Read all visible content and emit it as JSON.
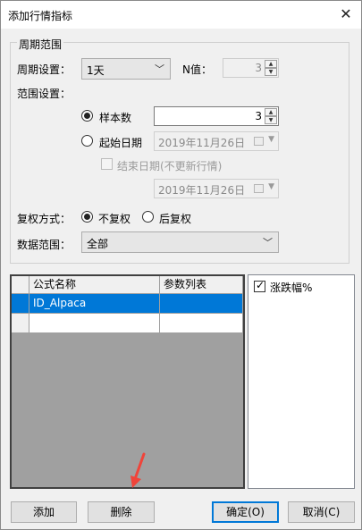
{
  "window": {
    "title": "添加行情指标",
    "close_glyph": "✕"
  },
  "period_group": {
    "title": "周期范围",
    "period_label": "周期设置：",
    "period_value": "1天",
    "n_label": "N值：",
    "n_value": "3",
    "range_label": "范围设置：",
    "sample_label": "样本数",
    "sample_value": "3",
    "start_date_label": "起始日期",
    "start_date_value": "2019年11月26日",
    "end_date_label": "结束日期(不更新行情)",
    "end_date_value": "2019年11月26日",
    "adjust_label": "复权方式：",
    "no_adjust_label": "不复权",
    "back_adjust_label": "后复权",
    "data_range_label": "数据范围：",
    "data_range_value": "全部"
  },
  "formula_table": {
    "columns": [
      "公式名称",
      "参数列表"
    ],
    "rows": [
      {
        "name": "ID_Alpaca",
        "params": ""
      }
    ]
  },
  "indicator_panel": {
    "item_label": "涨跌幅%",
    "checked": true
  },
  "buttons": {
    "add": "添加",
    "delete": "删除",
    "ok": "确定(O)",
    "cancel": "取消(C)"
  },
  "colors": {
    "selection": "#0078d7",
    "annotation_arrow": "#f0443a"
  },
  "icons": {
    "dropdown": "chevron-down-icon",
    "spin_up": "up-triangle-icon",
    "spin_down": "down-triangle-icon",
    "calendar": "calendar-icon"
  }
}
